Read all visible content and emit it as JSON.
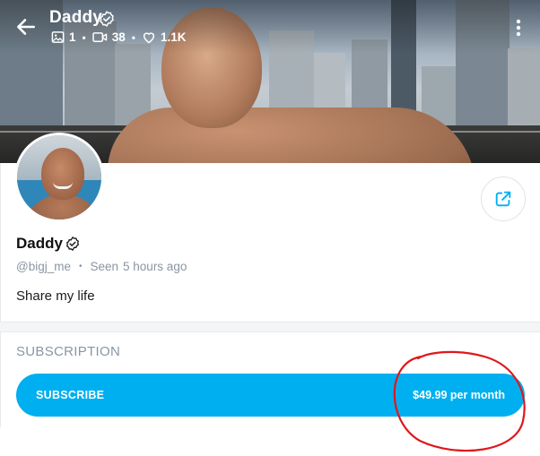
{
  "header": {
    "name": "Daddy",
    "stats": {
      "photos": "1",
      "videos": "38",
      "likes": "1.1K"
    }
  },
  "profile": {
    "name": "Daddy",
    "username": "@bigj_me",
    "seen_label": "Seen",
    "seen_time": "5 hours ago",
    "bio": "Share my life"
  },
  "subscription": {
    "heading": "SUBSCRIPTION",
    "button_label": "SUBSCRIBE",
    "price": "$49.99 per month"
  },
  "colors": {
    "accent": "#00aff0",
    "muted_text": "#8a96a3",
    "annotation": "#e0171b"
  },
  "icons": [
    "back-arrow-icon",
    "verified-badge-icon",
    "image-icon",
    "video-icon",
    "heart-icon",
    "more-vertical-icon",
    "share-icon"
  ]
}
